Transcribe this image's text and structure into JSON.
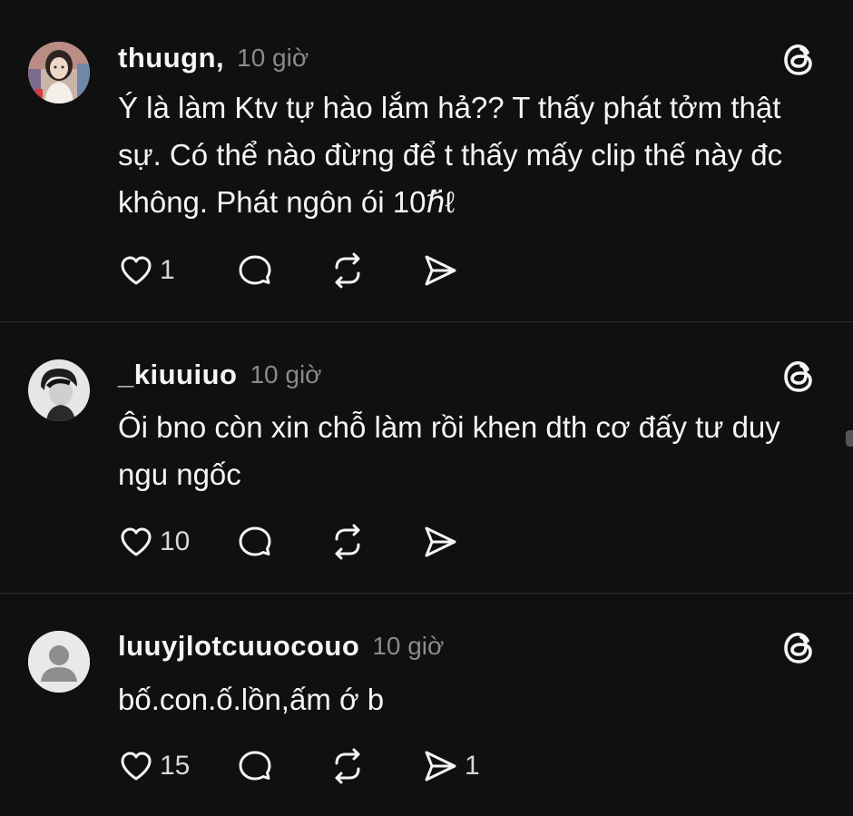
{
  "posts": [
    {
      "username": "thuugn,",
      "timestamp": "10 giờ",
      "text": "Ý là làm Ktv tự hào lắm hả?? T thấy phát tởm thật sự. Có thể nào đừng để t thấy mấy clip thế này đc không. Phát ngôn ói 10ℏ̈ℓ",
      "likes": "1",
      "shares": ""
    },
    {
      "username": "_kiuuiuo",
      "timestamp": "10 giờ",
      "text": "Ôi bno còn xin chỗ làm rồi khen dth cơ đấy tư duy ngu ngốc",
      "likes": "10",
      "shares": ""
    },
    {
      "username": "luuyjlotcuuocouo",
      "timestamp": "10 giờ",
      "text": "bố.con.ố.lồn,ấm ớ b",
      "likes": "15",
      "shares": "1"
    }
  ],
  "icons": {
    "like": "heart-icon",
    "reply": "comment-bubble-icon",
    "repost": "repost-icon",
    "share": "send-icon",
    "logo": "threads-logo-icon"
  },
  "colors": {
    "background": "#101010",
    "text": "#f3f5f7",
    "muted": "#8a8a8a",
    "divider": "#2f2f2f"
  }
}
